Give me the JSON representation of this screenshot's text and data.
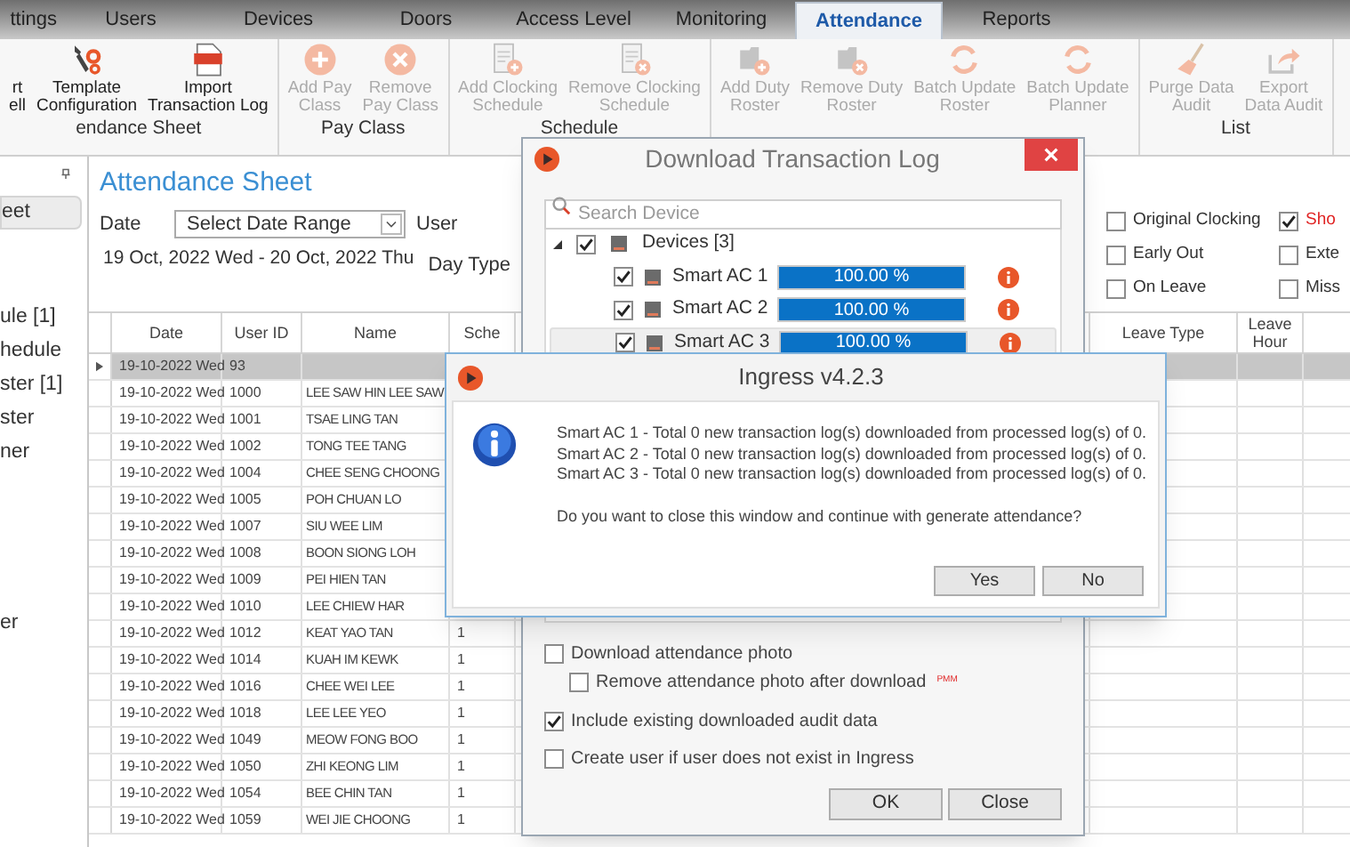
{
  "tabs": [
    {
      "label": "ttings",
      "selected": false
    },
    {
      "label": "Users",
      "selected": false
    },
    {
      "label": "Devices",
      "selected": false
    },
    {
      "label": "Doors",
      "selected": false
    },
    {
      "label": "Access Level",
      "selected": false
    },
    {
      "label": "Monitoring",
      "selected": false
    },
    {
      "label": "Attendance",
      "selected": true
    },
    {
      "label": "Reports",
      "selected": false
    }
  ],
  "ribbon": {
    "groups": [
      {
        "label": "endance Sheet",
        "buttons": [
          {
            "lines": [
              "rt",
              "ell"
            ],
            "disabled": false
          },
          {
            "lines": [
              "Template",
              "Configuration"
            ],
            "disabled": false
          },
          {
            "lines": [
              "Import",
              "Transaction Log"
            ],
            "disabled": false
          }
        ]
      },
      {
        "label": "Pay Class",
        "buttons": [
          {
            "lines": [
              "Add Pay",
              "Class"
            ],
            "disabled": true
          },
          {
            "lines": [
              "Remove",
              "Pay Class"
            ],
            "disabled": true
          }
        ]
      },
      {
        "label": "Schedule",
        "buttons": [
          {
            "lines": [
              "Add Clocking",
              "Schedule"
            ],
            "disabled": true
          },
          {
            "lines": [
              "Remove Clocking",
              "Schedule"
            ],
            "disabled": true
          }
        ]
      },
      {
        "buttons": [
          {
            "lines": [
              "Add Duty",
              "Roster"
            ],
            "disabled": true
          },
          {
            "lines": [
              "Remove Duty",
              "Roster"
            ],
            "disabled": true
          },
          {
            "lines": [
              "Batch Update",
              "Roster"
            ],
            "disabled": true
          },
          {
            "lines": [
              "Batch Update",
              "Planner"
            ],
            "disabled": true
          }
        ]
      },
      {
        "label": "List",
        "buttons": [
          {
            "lines": [
              "Purge Data",
              "Audit"
            ],
            "disabled": true
          },
          {
            "lines": [
              "Export",
              "Data Audit"
            ],
            "disabled": true
          }
        ]
      }
    ]
  },
  "sidebar": {
    "items": [
      {
        "label": "eet",
        "selected": true
      },
      {
        "label": "ule [1]",
        "selected": false
      },
      {
        "label": "hedule",
        "selected": false
      },
      {
        "label": "ster [1]",
        "selected": false
      },
      {
        "label": "ster",
        "selected": false
      },
      {
        "label": "ner",
        "selected": false
      },
      {
        "label": "er",
        "selected": false
      }
    ]
  },
  "sheet": {
    "title": "Attendance Sheet",
    "date_label": "Date",
    "date_select": "Select Date Range",
    "user_label": "User",
    "date_range": "19 Oct, 2022 Wed - 20 Oct, 2022 Thu",
    "day_type_label": "Day Type",
    "filters": [
      {
        "label": "Original Clocking",
        "checked": false,
        "color": "#333333"
      },
      {
        "label": "Sho",
        "checked": true,
        "color": "#e02424"
      },
      {
        "label": "Early Out",
        "checked": false,
        "color": "#333333"
      },
      {
        "label": "Exte",
        "checked": false,
        "color": "#333333"
      },
      {
        "label": "On Leave",
        "checked": false,
        "color": "#333333"
      },
      {
        "label": "Miss",
        "checked": false,
        "color": "#333333"
      }
    ]
  },
  "table": {
    "columns": [
      "Date",
      "User ID",
      "Name",
      "Sche",
      "Leave Type",
      "Leave Hour"
    ],
    "rows": [
      {
        "date": "19-10-2022 Wed",
        "user_id": "93",
        "selected": true
      },
      {
        "date": "19-10-2022 Wed",
        "user_id": "1000",
        "name": "LEE SAW HIN LEE SAW",
        "selected": false
      },
      {
        "date": "19-10-2022 Wed",
        "user_id": "1001",
        "name": "TSAE LING TAN",
        "selected": false
      },
      {
        "date": "19-10-2022 Wed",
        "user_id": "1002",
        "name": "TONG TEE TANG",
        "selected": false
      },
      {
        "date": "19-10-2022 Wed",
        "user_id": "1004",
        "name": "CHEE SENG CHOONG",
        "selected": false
      },
      {
        "date": "19-10-2022 Wed",
        "user_id": "1005",
        "name": "POH CHUAN LO",
        "selected": false
      },
      {
        "date": "19-10-2022 Wed",
        "user_id": "1007",
        "name": "SIU WEE LIM",
        "selected": false
      },
      {
        "date": "19-10-2022 Wed",
        "user_id": "1008",
        "name": "BOON SIONG LOH",
        "selected": false
      },
      {
        "date": "19-10-2022 Wed",
        "user_id": "1009",
        "name": "PEI HIEN TAN",
        "selected": false
      },
      {
        "date": "19-10-2022 Wed",
        "user_id": "1010",
        "name": "LEE CHIEW HAR",
        "selected": false
      },
      {
        "date": "19-10-2022 Wed",
        "user_id": "1012",
        "name": "KEAT YAO TAN",
        "sche": "1",
        "selected": false
      },
      {
        "date": "19-10-2022 Wed",
        "user_id": "1014",
        "name": "KUAH IM KEWK",
        "sche": "1",
        "selected": false
      },
      {
        "date": "19-10-2022 Wed",
        "user_id": "1016",
        "name": "CHEE WEI LEE",
        "sche": "1",
        "selected": false
      },
      {
        "date": "19-10-2022 Wed",
        "user_id": "1018",
        "name": "LEE LEE YEO",
        "sche": "1",
        "selected": false
      },
      {
        "date": "19-10-2022 Wed",
        "user_id": "1049",
        "name": "MEOW FONG BOO",
        "sche": "1",
        "selected": false
      },
      {
        "date": "19-10-2022 Wed",
        "user_id": "1050",
        "name": "ZHI KEONG LIM",
        "sche": "1",
        "selected": false
      },
      {
        "date": "19-10-2022 Wed",
        "user_id": "1054",
        "name": "BEE CHIN TAN",
        "sche": "1",
        "selected": false
      },
      {
        "date": "19-10-2022 Wed",
        "user_id": "1059",
        "name": "WEI JIE CHOONG",
        "sche": "1",
        "selected": false
      }
    ]
  },
  "download_dialog": {
    "title": "Download Transaction Log",
    "search": {
      "placeholder": "Search Device"
    },
    "tree": {
      "label": "Devices [3]",
      "checked": true,
      "expanded": true,
      "children": [
        {
          "label": "Smart AC 1",
          "checked": true,
          "selected": false,
          "level": 1,
          "reading": "100.00 %"
        },
        {
          "label": "Smart AC 2",
          "checked": true,
          "selected": false,
          "level": 1,
          "reading": "100.00 %"
        },
        {
          "label": "Smart AC 3",
          "checked": true,
          "selected": true,
          "level": 1,
          "reading": "100.00 %"
        }
      ]
    },
    "options": [
      {
        "label": "Download attendance photo",
        "checked": false,
        "kind": "main"
      },
      {
        "label": "Remove attendance photo after download",
        "checked": false,
        "kind": "sub",
        "tag": "PMM"
      },
      {
        "label": "Include existing downloaded audit data",
        "checked": true,
        "kind": "main"
      },
      {
        "label": "Create user if user does not exist in Ingress",
        "checked": false,
        "kind": "main"
      }
    ],
    "buttons": [
      "OK",
      "Close"
    ]
  },
  "message_box": {
    "title": "Ingress v4.2.3",
    "lines": [
      "Smart AC 1 - Total 0 new transaction log(s) downloaded from processed log(s) of 0.",
      "Smart AC 2 - Total 0 new transaction log(s) downloaded from processed log(s) of 0.",
      "Smart AC 3 - Total 0 new transaction log(s) downloaded from processed log(s) of 0."
    ],
    "question": "Do you want to close this window and continue with generate attendance?",
    "buttons": [
      "Yes",
      "No"
    ]
  }
}
